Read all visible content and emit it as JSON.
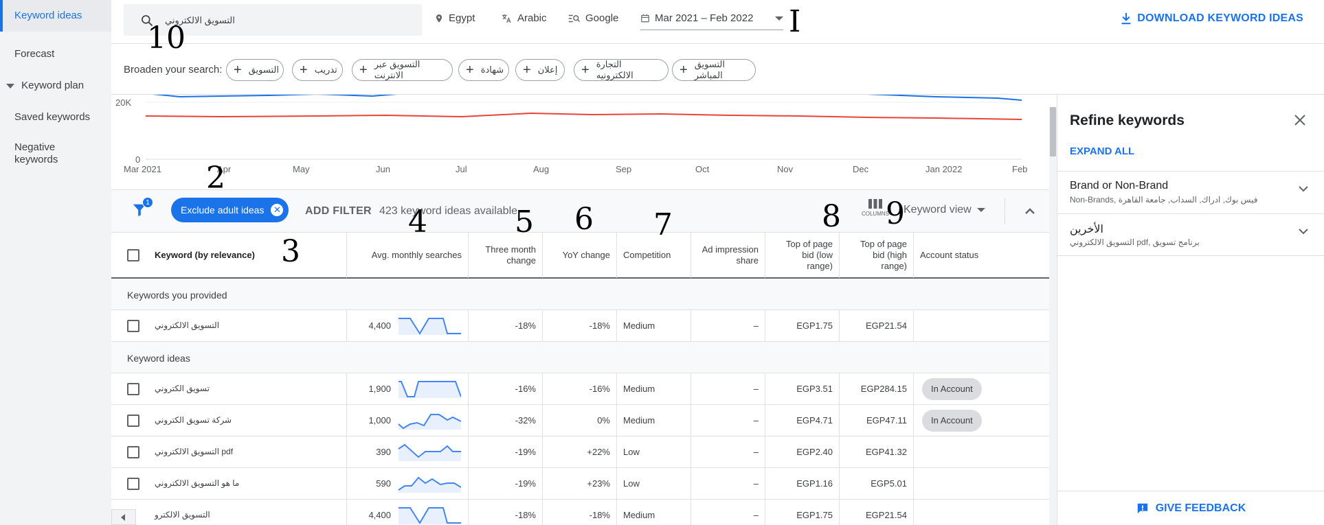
{
  "nav": {
    "items": [
      {
        "label": "Keyword ideas",
        "active": true
      },
      {
        "label": "Forecast"
      },
      {
        "label": "Keyword plan"
      },
      {
        "label": "Saved keywords"
      },
      {
        "label": "Negative keywords",
        "line1": "Negative",
        "line2": "keywords"
      }
    ]
  },
  "topbar": {
    "search_value": "التسويق الالكتروني",
    "location": "Egypt",
    "language": "Arabic",
    "network": "Google",
    "date_range": "Mar 2021 – Feb 2022",
    "download_label": "DOWNLOAD KEYWORD IDEAS"
  },
  "broaden": {
    "label": "Broaden your search:",
    "chips": [
      "التسويق",
      "تدريب",
      "التسويق عبر الانترنت",
      "شهادة",
      "إعلان",
      "التجارة الالكترونيه",
      "التسويق المباشر"
    ]
  },
  "chart": {
    "y_ticks": [
      "20K",
      "0"
    ],
    "x_ticks": [
      "Mar 2021",
      "Apr",
      "May",
      "Jun",
      "Jul",
      "Aug",
      "Sep",
      "Oct",
      "Nov",
      "Dec",
      "Jan 2022",
      "Feb"
    ],
    "colors": {
      "blue": "#1a73e8",
      "red": "#ea4335"
    }
  },
  "filterbar": {
    "filter_badge_count": "1",
    "exclude_chip": "Exclude adult ideas",
    "add_filter": "ADD FILTER",
    "available": "423 keyword ideas available",
    "columns_label": "COLUMNS",
    "view_label": "Keyword view"
  },
  "table": {
    "headers": {
      "keyword": "Keyword (by relevance)",
      "avg": "Avg. monthly searches",
      "three_month": "Three month change",
      "yoy": "YoY change",
      "competition": "Competition",
      "impr": "Ad impression share",
      "low_bid": "Top of page bid (low range)",
      "high_bid": "Top of page bid (high range)",
      "status": "Account status"
    },
    "section_provided": "Keywords you provided",
    "section_ideas": "Keyword ideas",
    "rows": [
      {
        "keyword": "التسويق الالكتروني",
        "avg": "4,400",
        "three": "-18%",
        "yoy": "-18%",
        "comp": "Medium",
        "impr": "–",
        "low": "EGP1.75",
        "high": "EGP21.54",
        "status": ""
      },
      {
        "keyword": "تسويق الكتروني",
        "avg": "1,900",
        "three": "-16%",
        "yoy": "-16%",
        "comp": "Medium",
        "impr": "–",
        "low": "EGP3.51",
        "high": "EGP284.15",
        "status": "In Account"
      },
      {
        "keyword": "شركة تسويق الكتروني",
        "avg": "1,000",
        "three": "-32%",
        "yoy": "0%",
        "comp": "Medium",
        "impr": "–",
        "low": "EGP4.71",
        "high": "EGP47.11",
        "status": "In Account"
      },
      {
        "keyword": "التسويق الالكتروني pdf",
        "avg": "390",
        "three": "-19%",
        "yoy": "+22%",
        "comp": "Low",
        "impr": "–",
        "low": "EGP2.40",
        "high": "EGP41.32",
        "status": ""
      },
      {
        "keyword": "ما هو التسويق الالكتروني",
        "avg": "590",
        "three": "-19%",
        "yoy": "+23%",
        "comp": "Low",
        "impr": "–",
        "low": "EGP1.16",
        "high": "EGP5.01",
        "status": ""
      },
      {
        "keyword": "التسويق الالكترو",
        "avg": "4,400",
        "three": "-18%",
        "yoy": "-18%",
        "comp": "Medium",
        "impr": "–",
        "low": "EGP1.75",
        "high": "EGP21.54",
        "status": ""
      }
    ]
  },
  "refine": {
    "title": "Refine keywords",
    "expand_all": "EXPAND ALL",
    "groups": [
      {
        "title": "Brand or Non-Brand",
        "sub": "Non-Brands, فيس بوك, ادراك, السداب, جامعة القاهرة"
      },
      {
        "title": "الأخرين",
        "sub": "التسويق الالكتروني pdf, برنامج تسويق"
      }
    ],
    "feedback": "GIVE FEEDBACK"
  },
  "annotations": [
    "10",
    "I",
    "2",
    "3",
    "4",
    "5",
    "6",
    "7",
    "8",
    "9"
  ]
}
